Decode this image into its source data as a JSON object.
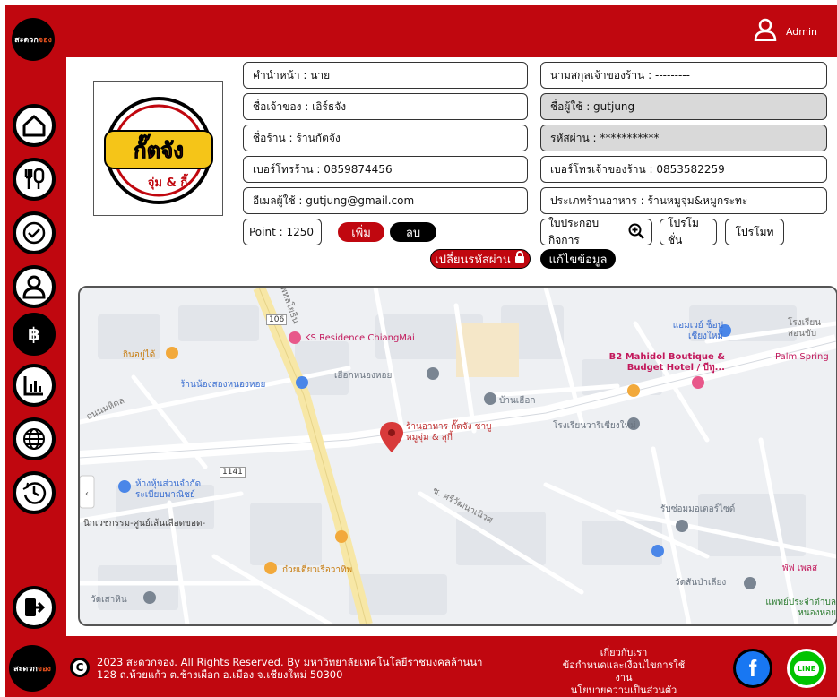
{
  "brand": {
    "logo_text_main": "สะดวก",
    "logo_text_accent": "จอง"
  },
  "header": {
    "username": "Admin",
    "user_icon": "user-icon"
  },
  "sidebar": {
    "items": [
      {
        "name": "home-icon"
      },
      {
        "name": "food-menu-icon"
      },
      {
        "name": "check-icon"
      },
      {
        "name": "user-icon"
      },
      {
        "name": "bitcoin-icon"
      },
      {
        "name": "chart-icon"
      },
      {
        "name": "globe-icon"
      },
      {
        "name": "clock-history-icon"
      }
    ],
    "logout_icon": "logout-icon"
  },
  "shop_logo": {
    "title": "กั๊ตจัง",
    "subtitle": "จุ่ม & กี้"
  },
  "form": {
    "prefix": "คำนำหน้า : นาย",
    "owner_name": "ชื่อเจ้าของ : เอิร์ธจัง",
    "shop_name": "ชื่อร้าน : ร้านกัตจัง",
    "shop_phone": "เบอร์โทรร้าน : 0859874456",
    "email": "อีเมลผู้ใช้ : gutjung@gmail.com",
    "owner_lastname": "นามสกุลเจ้าของร้าน : ---------",
    "username": "ชื่อผู้ใช้ : gutjung",
    "password": "รหัสผ่าน : ***********",
    "owner_phone": "เบอร์โทรเจ้าของร้าน : 0853582259",
    "food_type": "ประเภทร้านอาหาร : ร้านหมูจุ่ม&หมูกระทะ",
    "point": "Point  : 1250",
    "add_label": "เพิ่ม",
    "subtract_label": "ลบ",
    "license_label": "ใบประกอบกิจการ",
    "promotion_label": "โปรโมชั่น",
    "promote_label": "โปรโมท",
    "change_password_label": "เปลี่ยนรหัสผ่าน",
    "edit_label": "แก้ไขข้อมูล"
  },
  "map": {
    "main_pin": "ร้านอาหาร กั๊ตจัง ชาบู หมูจุ่ม & สุกี้",
    "labels": [
      "KS Residence ChiangMai",
      "กินอยู่ได้",
      "ร้านน้องสองหนองหอย",
      "เฮือกหนองหอย",
      "บ้านเฮือก",
      "โรงเรียนวารีเชียงใหม่",
      "แอมเวย์ ช็อป เชียงใหม่",
      "B2 Mahidol Boutique & Budget Hotel / บีทู...",
      "Palm Spring",
      "ห้างหุ้นส่วนจำกัด ระเบียบพาณิชย์",
      "ก๋วยเตี๋ยวเรือวาทิพ",
      "รับซ่อมมอเตอร์ไซด์",
      "วัดสันป่าเลียง",
      "พัฟ เพลส",
      "วัดเสาหิน",
      "แพทย์ประจำตำบลหนองหอย",
      "นิกเวชกรรม-ศูนย์เส้นเลือดขอด-",
      "ถนนมหิดล",
      "ซ. ศรีวัฒนาเนิวศ",
      "โรงเรียนสอนขับ",
      "พหลโยธิน",
      "1141",
      "106"
    ]
  },
  "footer": {
    "copyright_line1": "2023 สะดวกจอง. All Rights Reserved. By มหาวิทยาลัยเทคโนโลยีราชมงคลล้านนา",
    "copyright_line2": "128 ถ.ห้วยแก้ว ต.ช้างเผือก อ.เมือง จ.เชียงใหม่ 50300",
    "link_about": "เกี่ยวกับเรา",
    "link_terms": "ข้อกำหนดและเงื่อนไขการใช้งาน",
    "link_privacy": "นโยบายความเป็นส่วนตัว",
    "facebook_icon": "facebook-icon",
    "line_icon": "line-icon",
    "line_text": "LINE"
  },
  "colors": {
    "brand_red": "#c0070f",
    "black": "#000000",
    "map_pin": "#d83a3a"
  }
}
